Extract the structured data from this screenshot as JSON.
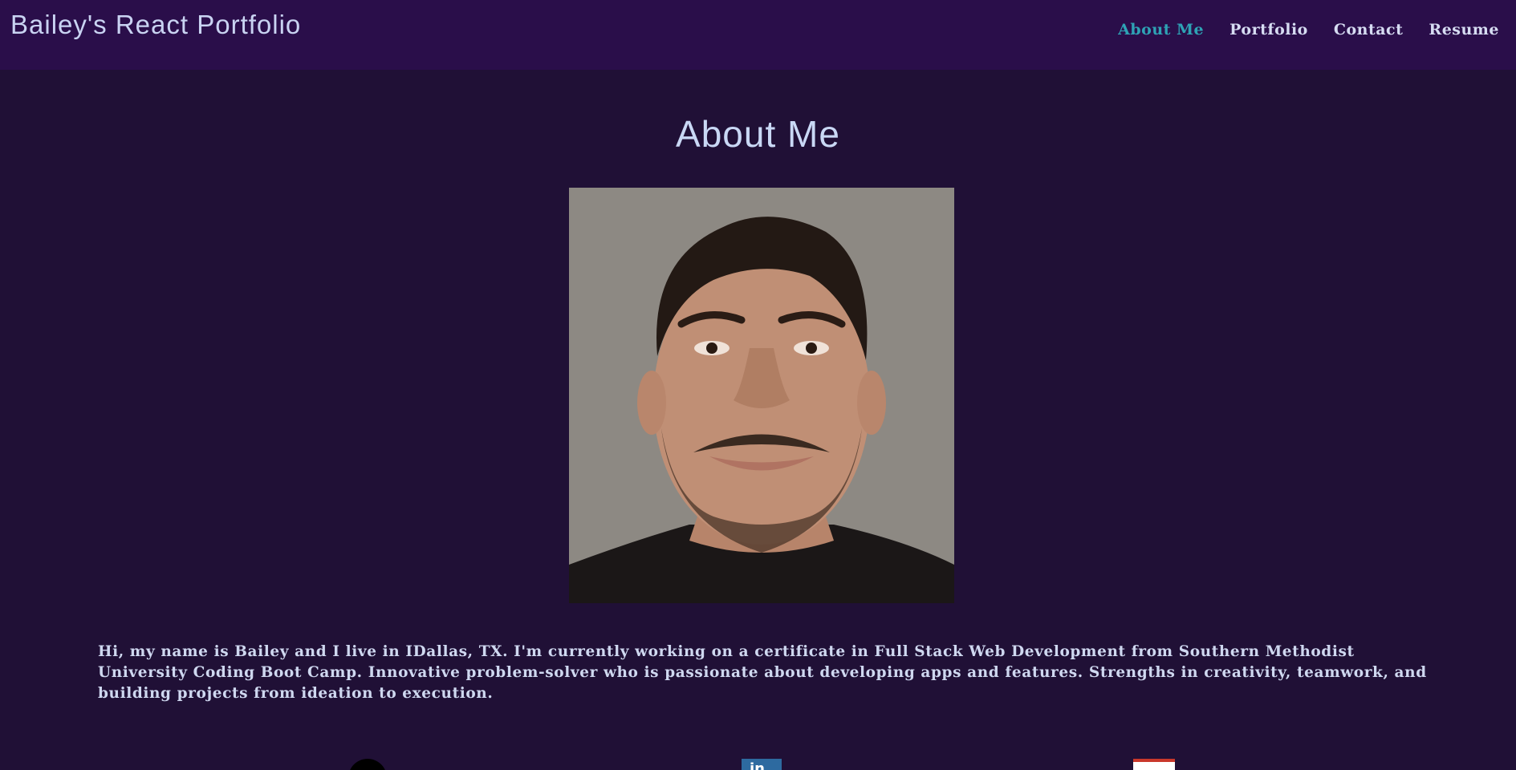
{
  "header": {
    "brand": "Bailey's React Portfolio",
    "nav": [
      {
        "label": "About Me",
        "active": true
      },
      {
        "label": "Portfolio",
        "active": false
      },
      {
        "label": "Contact",
        "active": false
      },
      {
        "label": "Resume",
        "active": false
      }
    ]
  },
  "main": {
    "title": "About Me",
    "bio": "Hi, my name is Bailey and I live in IDallas, TX. I'm currently working on a certificate in Full Stack Web Development from Southern Methodist University Coding Boot Camp. Innovative problem-solver who is passionate about developing apps and features. Strengths in creativity, teamwork, and building projects from ideation to execution."
  },
  "social": {
    "icons": [
      "github-icon",
      "linkedin-icon",
      "email-icon"
    ],
    "linkedin_glyph": "in"
  },
  "colors": {
    "background": "#201036",
    "navbar": "#2a0e4a",
    "active_link": "#2ea3b5",
    "text": "#cfd8f0"
  }
}
